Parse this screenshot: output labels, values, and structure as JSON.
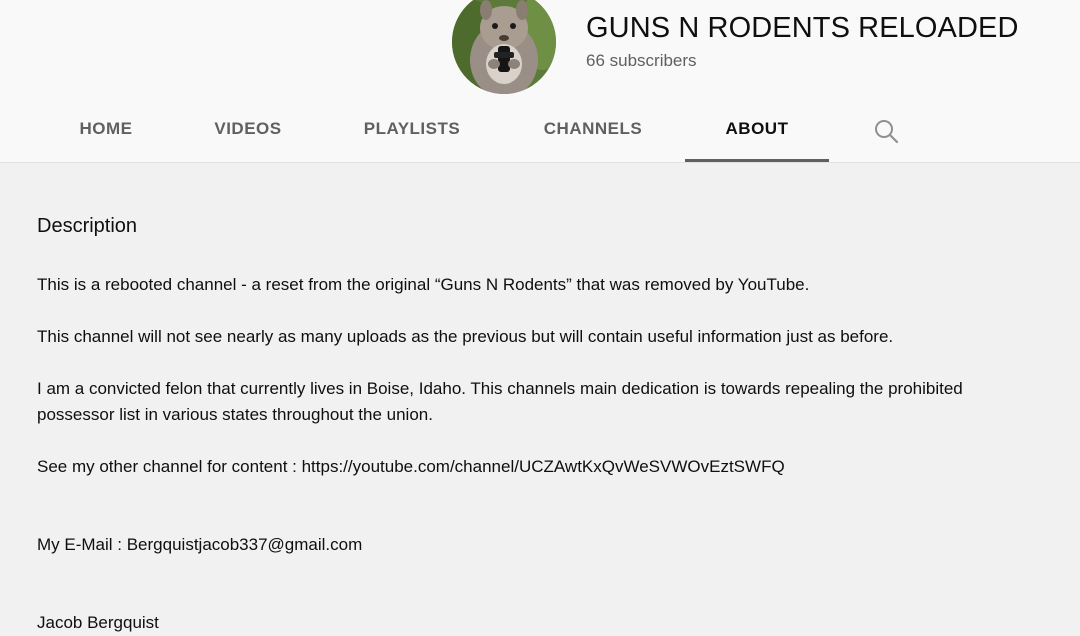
{
  "channel": {
    "title": "GUNS N RODENTS RELOADED",
    "subscribers": "66 subscribers",
    "avatar_icon": "squirrel-avatar-icon"
  },
  "tabs": [
    {
      "label": "HOME",
      "active": false
    },
    {
      "label": "VIDEOS",
      "active": false
    },
    {
      "label": "PLAYLISTS",
      "active": false
    },
    {
      "label": "CHANNELS",
      "active": false
    },
    {
      "label": "ABOUT",
      "active": true
    }
  ],
  "search_icon": "search-icon",
  "about": {
    "heading": "Description",
    "lines": [
      "This is a rebooted channel - a reset from the original “Guns N Rodents” that was removed by YouTube.",
      "This channel will not see nearly as many uploads as the previous but will contain useful information just as before.",
      "I am a convicted felon that currently lives in Boise, Idaho. This channels main dedication is towards repealing the prohibited",
      "possessor list in various states throughout the union.",
      "See my other channel for content : https://youtube.com/channel/UCZAwtKxQvWeSVWOvEztSWFQ",
      "My E-Mail : Bergquistjacob337@gmail.com",
      "Jacob Bergquist"
    ]
  },
  "colors": {
    "page_bg": "#f1f1f1",
    "header_bg": "#f9f9f9",
    "text_primary": "#0f0f0f",
    "text_secondary": "#606060"
  }
}
